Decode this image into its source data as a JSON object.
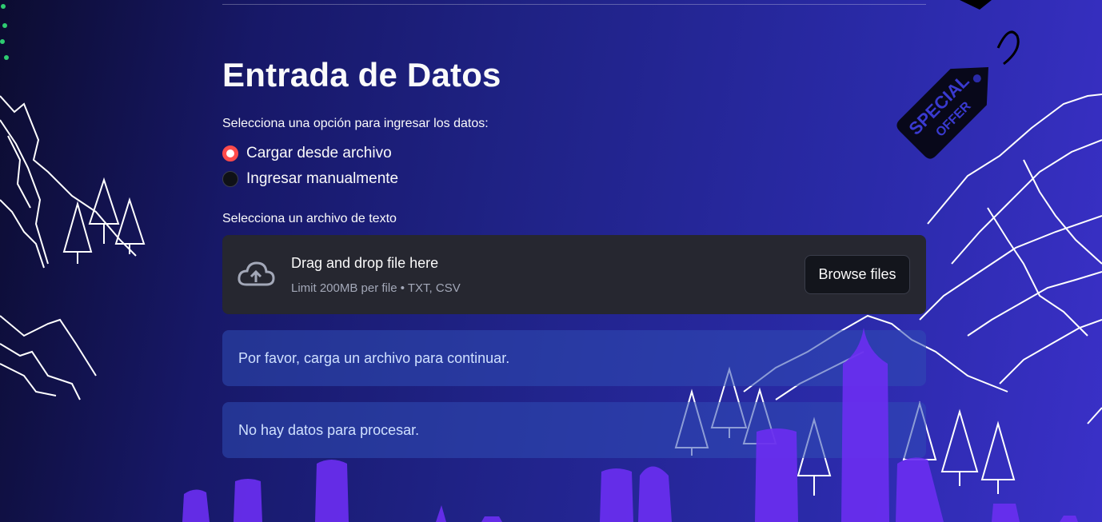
{
  "page": {
    "title": "Entrada de Datos"
  },
  "radio_group": {
    "prompt": "Selecciona una opción para ingresar los datos:",
    "options": [
      {
        "label": "Cargar desde archivo",
        "selected": true
      },
      {
        "label": "Ingresar manualmente",
        "selected": false
      }
    ]
  },
  "uploader": {
    "label": "Selecciona un archivo de texto",
    "drop_text": "Drag and drop file here",
    "limit_text": "Limit 200MB per file • TXT, CSV",
    "browse_label": "Browse files",
    "icon": "cloud-upload-icon"
  },
  "alerts": [
    {
      "text": "Por favor, carga un archivo para continuar."
    },
    {
      "text": "No hay datos para procesar."
    }
  ],
  "decoration": {
    "tag_line1": "SPECIAL",
    "tag_line2": "OFFER"
  },
  "colors": {
    "accent": "#ff4b4b",
    "skyline": "#6a2ef0",
    "info_text": "#cfe0ff"
  }
}
